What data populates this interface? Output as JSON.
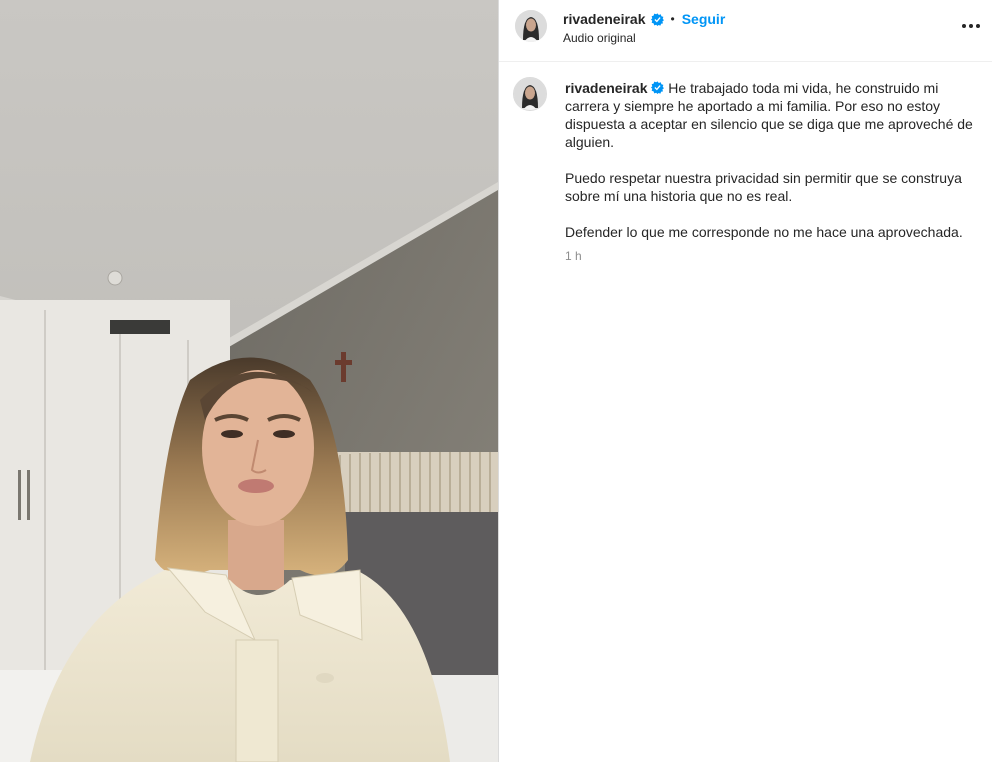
{
  "post": {
    "username": "rivadeneirak",
    "follow_label": "Seguir",
    "audio_label": "Audio original",
    "caption_paragraphs": [
      "He trabajado toda mi vida, he construido mi carrera y siempre he aportado a mi familia. Por eso no estoy dispuesta a aceptar en silencio que se diga que me aproveché de alguien.",
      "Puedo respetar nuestra privacidad sin permitir que se construya sobre mí una historia que no es real.",
      "Defender lo que me corresponde no me hace una aprovechada."
    ],
    "timestamp": "1 h"
  },
  "icons": {
    "verified": "verified-badge-icon",
    "more": "more-options-icon"
  },
  "colors": {
    "follow": "#0095f6",
    "verified": "#0095f6",
    "text": "#262626",
    "muted": "#8e8e8e"
  }
}
